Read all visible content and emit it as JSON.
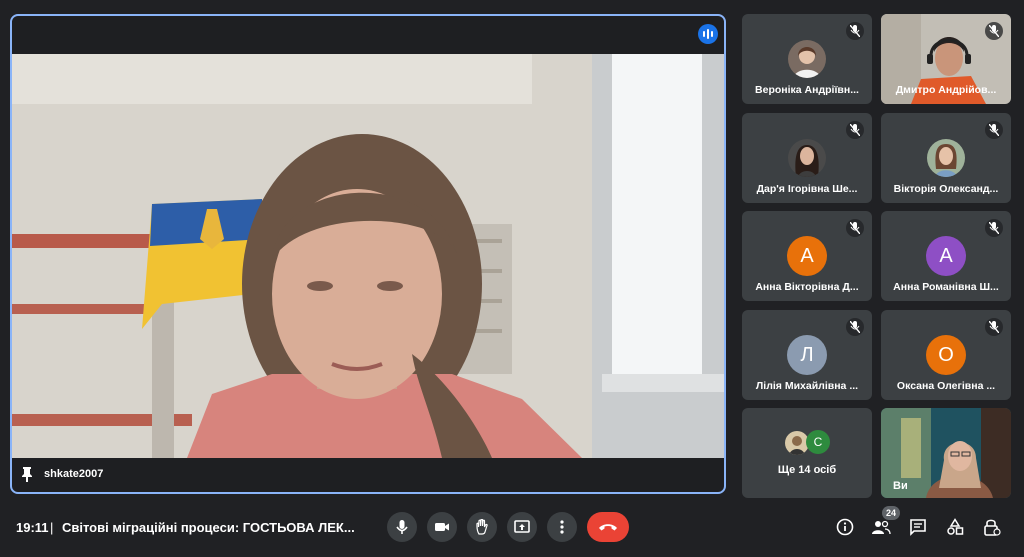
{
  "meeting": {
    "time": "19:11",
    "separator": "|",
    "title": "Світові міграційні процеси: ГОСТЬОВА ЛЕК..."
  },
  "main_tile": {
    "name": "shkate2007"
  },
  "participants": [
    {
      "name": "Вероніка Андріївн...",
      "kind": "photo"
    },
    {
      "name": "Дмитро Андрійов...",
      "kind": "video"
    },
    {
      "name": "Дар'я Ігорівна Ше...",
      "kind": "photo"
    },
    {
      "name": "Вікторія Олександ...",
      "kind": "photo"
    },
    {
      "name": "Анна Вікторівна Д...",
      "kind": "avatar",
      "initial": "А",
      "color": "#e8710a"
    },
    {
      "name": "Анна Романівна Ш...",
      "kind": "avatar",
      "initial": "А",
      "color": "#8e4fc5"
    },
    {
      "name": "Лілія Михайлівна ...",
      "kind": "avatar",
      "initial": "Л",
      "color": "#8b9bb0"
    },
    {
      "name": "Оксана Олегівна ...",
      "kind": "avatar",
      "initial": "О",
      "color": "#e8710a"
    }
  ],
  "more": {
    "label": "Ще 14 осіб",
    "initial": "С",
    "color": "#2e8b3e"
  },
  "self_tile": {
    "label": "Ви"
  },
  "people_count": "24",
  "colors": {
    "background": "#202124",
    "tile": "#3c4043",
    "active_border": "#8ab4f8",
    "end_call": "#ea4335"
  },
  "icons": {
    "controls": [
      "microphone-icon",
      "camera-icon",
      "raise-hand-icon",
      "present-screen-icon",
      "more-options-icon",
      "end-call-icon"
    ],
    "right": [
      "meeting-details-icon",
      "people-icon",
      "chat-icon",
      "activities-icon",
      "host-controls-icon"
    ]
  }
}
